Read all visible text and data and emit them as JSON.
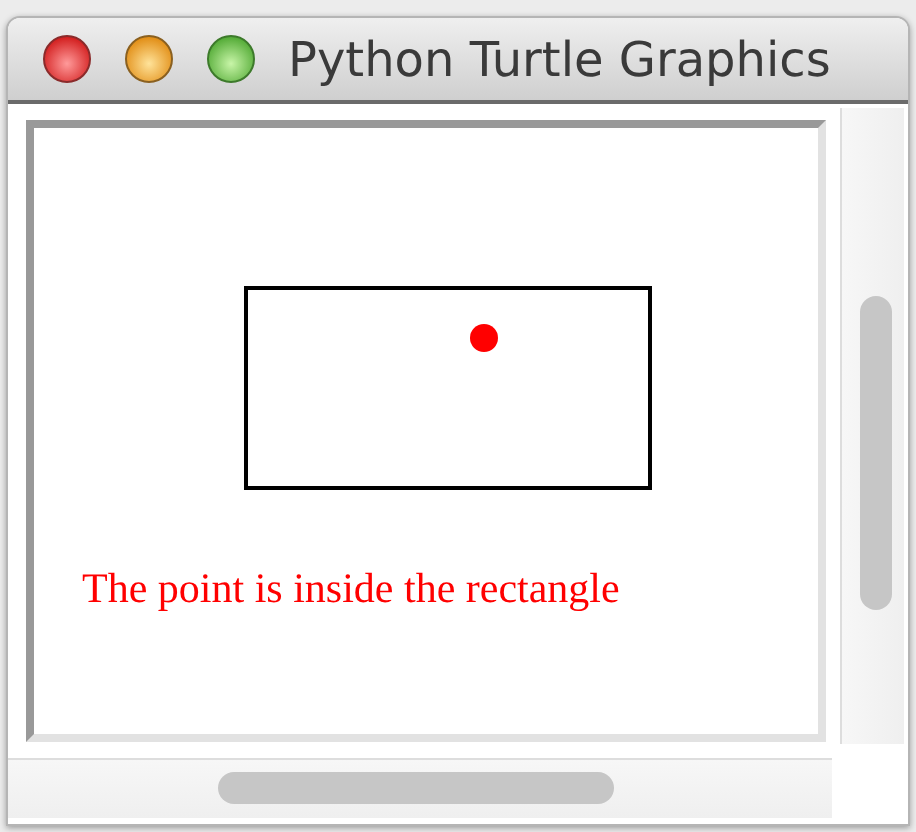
{
  "window": {
    "title": "Python Turtle Graphics"
  },
  "canvas": {
    "message": "The point is inside the rectangle"
  }
}
